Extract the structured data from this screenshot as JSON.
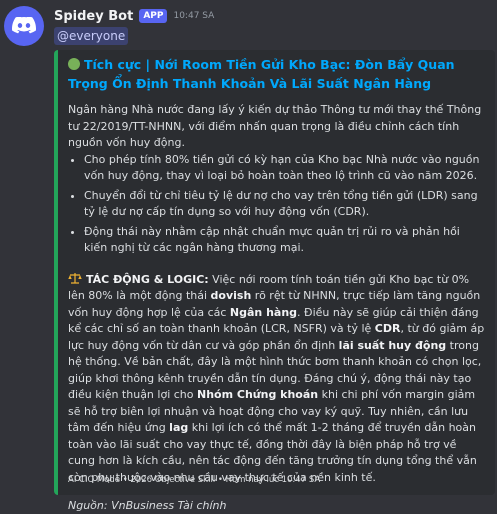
{
  "author": {
    "name": "Spidey Bot",
    "badge": "APP",
    "timestamp": "10:47 SA"
  },
  "mention": "@everyone",
  "embed": {
    "accent_color": "#23a55a",
    "title": "Tích cực | Nới Room Tiền Gửi Kho Bạc: Đòn Bẩy Quan Trọng Ổn Định Thanh Khoản Và Lãi Suất Ngân Hàng",
    "intro": "Ngân hàng Nhà nước đang lấy ý kiến dự thảo Thông tư mới thay thế Thông tư 22/2019/TT-NHNN, với điểm nhấn quan trọng là điều chỉnh cách tính nguồn vốn huy động.",
    "bullets": [
      "Cho phép tính 80% tiền gửi có kỳ hạn của Kho bạc Nhà nước vào nguồn vốn huy động, thay vì loại bỏ hoàn toàn theo lộ trình cũ vào năm 2026.",
      "Chuyển đổi từ chỉ tiêu tỷ lệ dư nợ cho vay trên tổng tiền gửi (LDR) sang tỷ lệ dư nợ cấp tín dụng so với huy động vốn (CDR).",
      "Động thái này nhằm cập nhật chuẩn mực quản trị rủi ro và phản hồi kiến nghị từ các ngân hàng thương mại."
    ],
    "impact": {
      "label": "TÁC ĐỘNG & LOGIC:",
      "t1": " Việc nới room tính toán tiền gửi Kho bạc từ 0% lên 80% là một động thái ",
      "b1": "dovish",
      "t2": " rõ rệt từ NHNN, trực tiếp làm tăng nguồn vốn huy động hợp lệ của các ",
      "b2": "Ngân hàng",
      "t3": ". Điều này sẽ giúp cải thiện đáng kể các chỉ số an toàn thanh khoản (LCR, NSFR) và tỷ lệ ",
      "b3": "CDR",
      "t4": ", từ đó giảm áp lực huy động vốn từ dân cư và góp phần ổn định ",
      "b4": "lãi suất huy động",
      "t5": " trong hệ thống. Về bản chất, đây là một hình thức bơm thanh khoản có chọn lọc, giúp khơi thông kênh truyền dẫn tín dụng. Đáng chú ý, động thái này tạo điều kiện thuận lợi cho ",
      "b5": "Nhóm Chứng khoán",
      "t6": " khi chi phí vốn margin giảm sẽ hỗ trợ biên lợi nhuận và hoạt động cho vay ký quỹ. Tuy nhiên, cần lưu tâm đến hiệu ứng ",
      "b6": "lag",
      "t7": " khi lợi ích có thể mất 1-2 tháng để truyền dẫn hoàn toàn vào lãi suất cho vay thực tế, đồng thời đây là biện pháp hỗ trợ về cung hơn là kích cầu, nên tác động đến tăng trưởng tín dụng tổng thể vẫn còn phụ thuộc vào nhu cầu vay thực tế của nền kinh tế."
    },
    "source": "Nguồn: VnBusiness Tài chính",
    "footer": "AI CIO Mode • 2026 Objective Skill • Hôm nay lúc 10:47 SA"
  },
  "colors": {
    "background": "#323339",
    "embed_bg": "#2b2d31",
    "title_link": "#00a8fc",
    "mention_bg": "#3c4270",
    "badge": "#5865f2"
  },
  "icons": {
    "avatar": "discord-logo-icon",
    "title": "green-circle-icon",
    "impact": "balance-scale-icon"
  }
}
